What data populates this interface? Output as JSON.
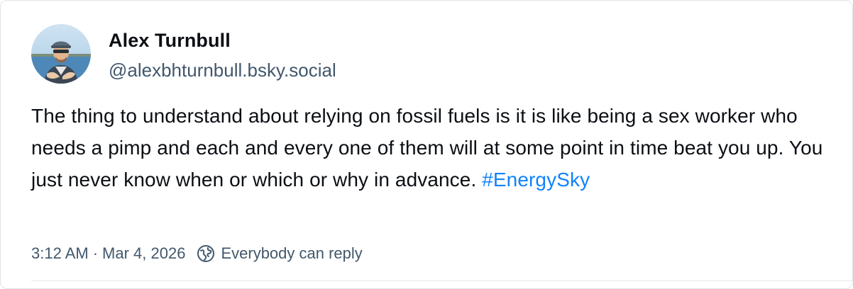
{
  "author": {
    "display_name": "Alex Turnbull",
    "handle": "@alexbhturnbull.bsky.social",
    "avatar_icon": "profile-photo"
  },
  "post": {
    "text": "The thing to understand about relying on fossil fuels is it is like being a sex worker who needs a pimp and each and every one of them will at some point in time beat you up. You just never know when or which or why in advance. ",
    "hashtag": "#EnergySky"
  },
  "meta": {
    "time": "3:12 AM",
    "separator": "·",
    "date": "Mar 4, 2026",
    "reply_icon": "globe-reply-icon",
    "reply_setting": "Everybody can reply"
  },
  "colors": {
    "text": "#0b0f14",
    "muted": "#42576c",
    "link": "#1083fe"
  }
}
